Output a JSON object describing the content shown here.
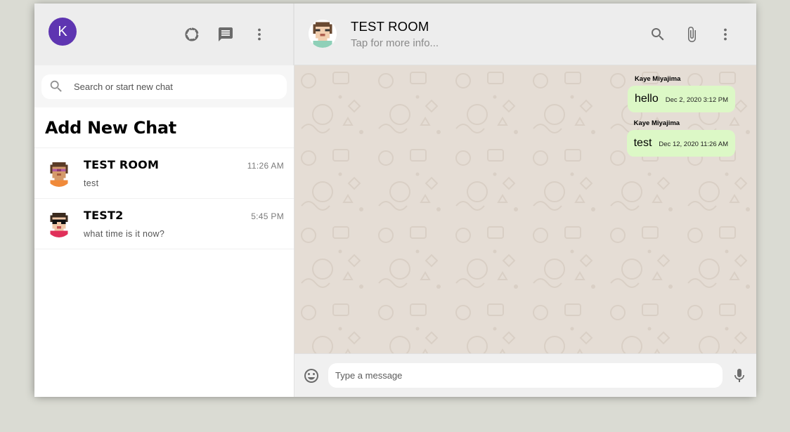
{
  "sidebar": {
    "avatar_letter": "K",
    "search": {
      "placeholder": "Search or start new chat"
    },
    "add_chat_label": "Add New Chat",
    "chats": [
      {
        "name": "TEST ROOM",
        "time": "11:26 AM",
        "last_message": "test"
      },
      {
        "name": "TEST2",
        "time": "5:45 PM",
        "last_message": "what time is it now?"
      }
    ]
  },
  "chat": {
    "title": "TEST ROOM",
    "subtitle": "Tap for more info...",
    "messages": [
      {
        "sender": "Kaye Miyajima",
        "text": "hello",
        "timestamp": "Dec 2, 2020 3:12 PM"
      },
      {
        "sender": "Kaye Miyajima",
        "text": "test",
        "timestamp": "Dec 12, 2020 11:26 AM"
      }
    ],
    "input": {
      "placeholder": "Type a message"
    }
  },
  "icons": {
    "status": "status-ring-icon",
    "new_chat": "message-icon",
    "menu": "more-vert-icon",
    "search": "search-icon",
    "attach": "attach-icon",
    "emoji": "emoji-icon",
    "mic": "mic-icon"
  },
  "colors": {
    "avatar_bg": "#5e35b1",
    "outgoing_bubble": "#dcf8c6",
    "chat_bg": "#e5ddd5",
    "header_bg": "#ededed"
  }
}
